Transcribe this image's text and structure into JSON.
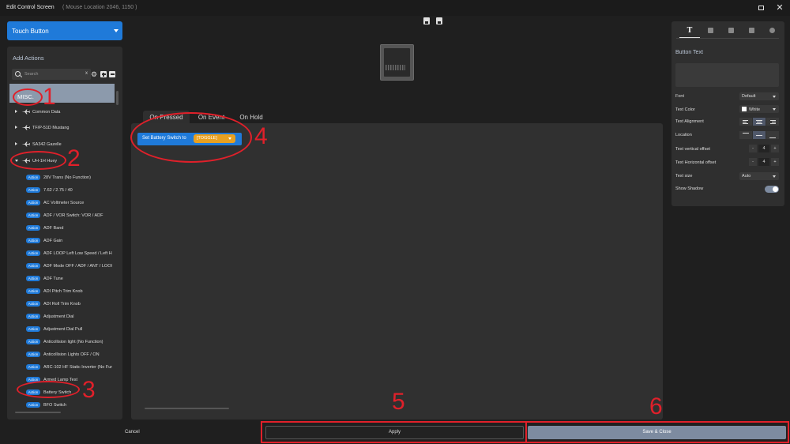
{
  "window": {
    "title": "Edit Control Screen",
    "mouse_location": "( Mouse Location 2046, 1150 )"
  },
  "left": {
    "control_type": "Touch Button",
    "section_title": "Add Actions",
    "search_placeholder": "Search",
    "search_clear": "x",
    "tree": {
      "misc": "MISC.",
      "categories": [
        {
          "label": "Common Data"
        },
        {
          "label": "TF/P-51D Mustang"
        },
        {
          "label": "SA342 Gazelle"
        },
        {
          "label": "UH-1H Huey"
        }
      ],
      "action_badge": "Action",
      "actions": [
        "28V Trans (No Function)",
        "7.62 / 2.75 / 40",
        "AC Voltmeter Source",
        "ADF / VOR Switch: VOR / ADF",
        "ADF Band",
        "ADF Gain",
        "ADF LOOP Left Low Speed / Left H",
        "ADF Mode OFF / ADF / ANT / LOOI",
        "ADF Tune",
        "ADI Pitch Trim Knob",
        "ADI Roll Trim Knob",
        "Adjustment Dial",
        "Adjustment Dial Pull",
        "Anticollision light (No Function)",
        "Anticollision Lights OFF / ON",
        "ARC-102 HF Static Inverter (No Fur",
        "Armed Lamp Test",
        "Battery Switch",
        "BFO Switch"
      ]
    }
  },
  "center": {
    "tabs": [
      "On Pressed",
      "On Event",
      "On Hold"
    ],
    "action_block": {
      "text": "Set Battery Switch to",
      "value": "[TOGGLE]"
    }
  },
  "right": {
    "section_title": "Button Text",
    "props": {
      "font_label": "Font",
      "font_value": "Default",
      "color_label": "Text Color",
      "color_value": "White",
      "align_label": "Text Alignment",
      "location_label": "Location",
      "voffset_label": "Text vertical offset",
      "voffset_value": "4",
      "hoffset_label": "Text Horizontal offset",
      "hoffset_value": "4",
      "size_label": "Text size",
      "size_value": "Auto",
      "shadow_label": "Show Shadow",
      "minus": "-",
      "plus": "+"
    }
  },
  "bottom": {
    "cancel": "Cancel",
    "apply": "Apply",
    "save": "Save & Close"
  },
  "annotations": [
    "1",
    "2",
    "3",
    "4",
    "5",
    "6"
  ],
  "colors": {
    "accent": "#1f7ad9",
    "toggle": "#e8a020",
    "annotation": "#e0202a",
    "selected": "#8c9aac",
    "save": "#7d8ba0"
  }
}
